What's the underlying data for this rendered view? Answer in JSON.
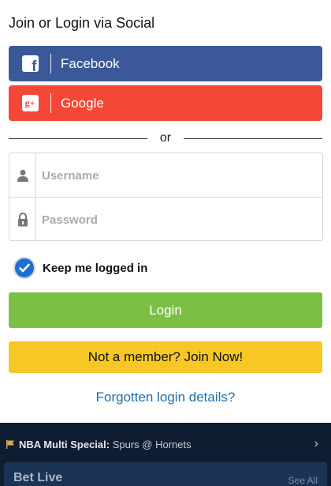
{
  "heading": "Join or Login via Social",
  "social": {
    "facebook_label": "Facebook",
    "google_label": "Google"
  },
  "divider_text": "or",
  "form": {
    "username_placeholder": "Username",
    "password_placeholder": "Password",
    "keep_logged_in_label": "Keep me logged in",
    "keep_logged_in_checked": true
  },
  "buttons": {
    "login_label": "Login",
    "join_label": "Not a member? Join Now!"
  },
  "forgot_link": "Forgotten login details?",
  "promo": {
    "title": "NBA Multi Special:",
    "matchup": "Spurs @ Hornets"
  },
  "bet_live": {
    "title": "Bet Live",
    "right_text": "See All"
  },
  "colors": {
    "facebook": "#3b5998",
    "google": "#f44736",
    "login": "#7bbf45",
    "join": "#f7c825",
    "link": "#1f6ea8",
    "background_dark": "#0f1d33"
  }
}
